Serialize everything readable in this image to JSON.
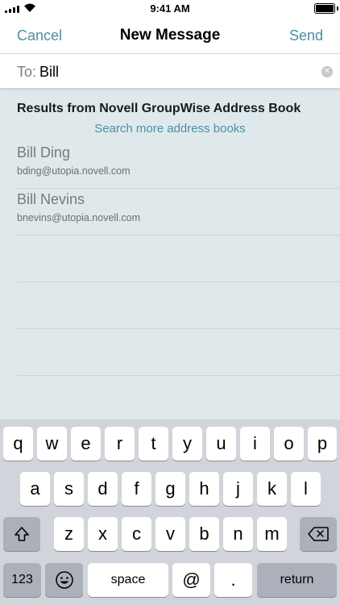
{
  "status_bar": {
    "time": "9:41 AM"
  },
  "nav": {
    "cancel_label": "Cancel",
    "title": "New Message",
    "send_label": "Send"
  },
  "to_field": {
    "label": "To:",
    "value": "Bill",
    "clear_icon": "clear-circle-icon"
  },
  "results": {
    "header": "Results from Novell GroupWise Address Book",
    "search_more_label": "Search more address books",
    "contacts": [
      {
        "name": "Bill Ding",
        "email": "bding@utopia.novell.com"
      },
      {
        "name": "Bill Nevins",
        "email": "bnevins@utopia.novell.com"
      }
    ]
  },
  "keyboard": {
    "row1": [
      "q",
      "w",
      "e",
      "r",
      "t",
      "y",
      "u",
      "i",
      "o",
      "p"
    ],
    "row2": [
      "a",
      "s",
      "d",
      "f",
      "g",
      "h",
      "j",
      "k",
      "l"
    ],
    "row3": [
      "z",
      "x",
      "c",
      "v",
      "b",
      "n",
      "m"
    ],
    "numbers_label": "123",
    "space_label": "space",
    "at_label": "@",
    "period_label": ".",
    "return_label": "return",
    "shift_icon": "shift-arrow-icon",
    "delete_icon": "delete-backspace-icon",
    "emoji_icon": "emoji-icon"
  },
  "colors": {
    "accent": "#4b8fa8",
    "results_bg": "#dfe9ec",
    "keyboard_bg": "#d1d5db"
  }
}
